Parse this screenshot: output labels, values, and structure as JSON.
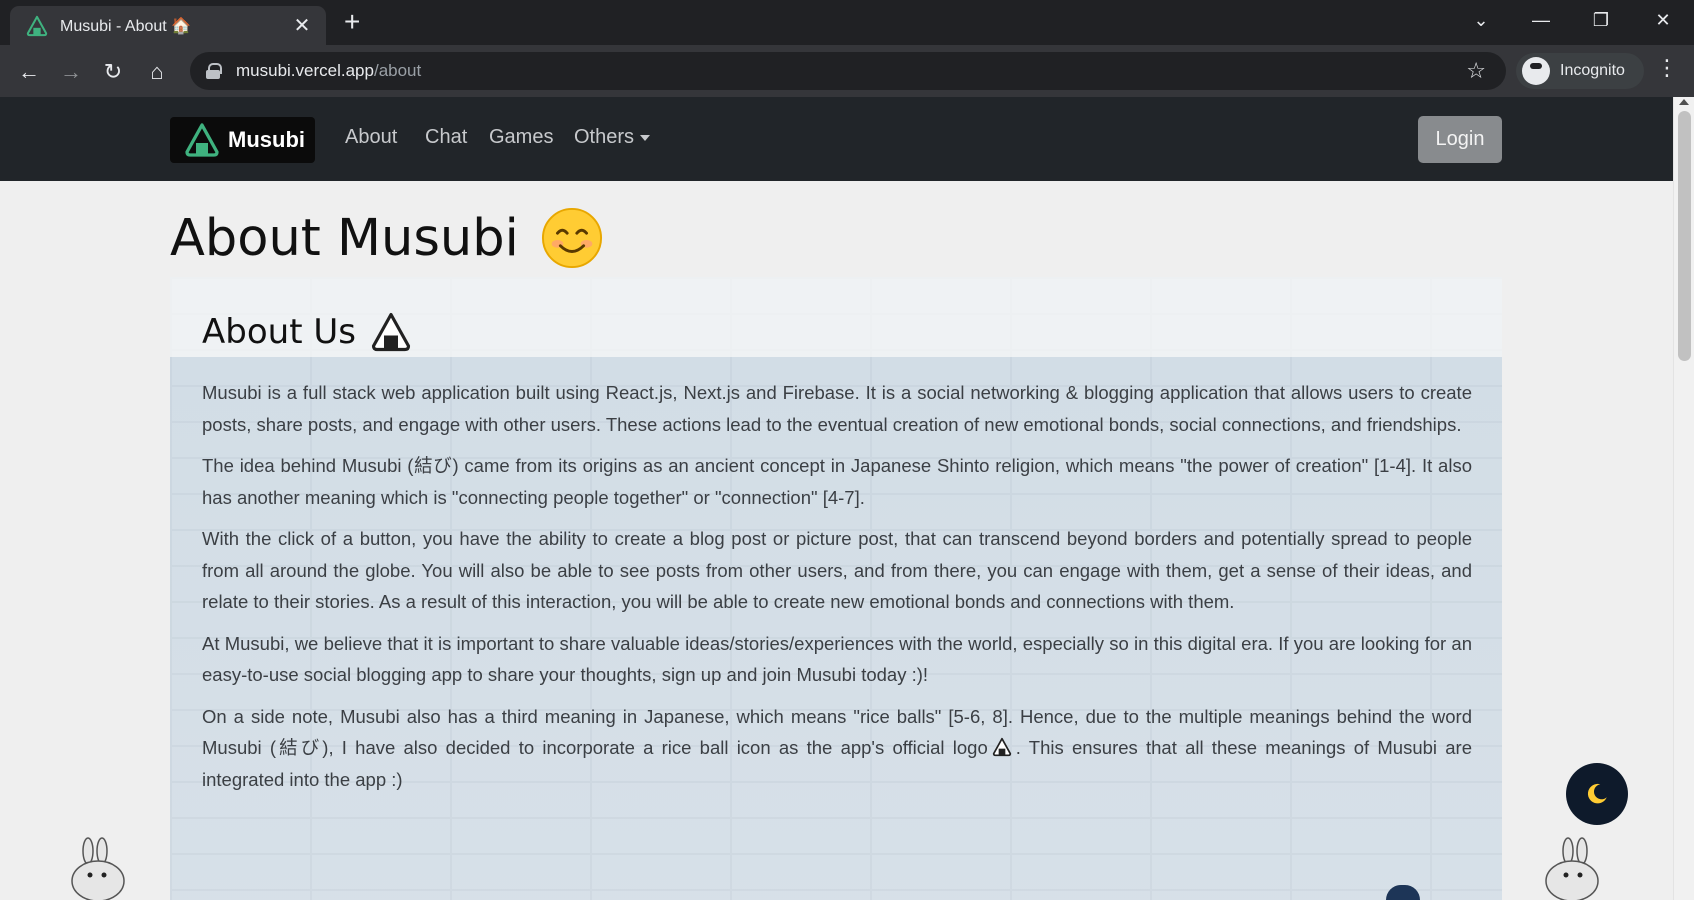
{
  "browser": {
    "tab_title": "Musubi - About 🏠",
    "new_tab_symbol": "+",
    "url_host": "musubi.vercel.app",
    "url_path": "/about",
    "profile_label": "Incognito"
  },
  "site": {
    "brand": "Musubi",
    "nav": {
      "about": "About",
      "chat": "Chat",
      "games": "Games",
      "others": "Others"
    },
    "login": "Login"
  },
  "page": {
    "title": "About Musubi",
    "section_heading": "About Us",
    "p1": "Musubi is a full stack web application built using React.js, Next.js and Firebase. It is a social networking & blogging application that allows users to create posts, share posts, and engage with other users. These actions lead to the eventual creation of new emotional bonds, social connections, and friendships.",
    "p2": "The idea behind Musubi (結び) came from its origins as an ancient concept in Japanese Shinto religion, which means \"the power of creation\" [1-4]. It also has another meaning which is \"connecting people together\" or \"connection\" [4-7].",
    "p3": "With the click of a button, you have the ability to create a blog post or picture post, that can transcend beyond borders and potentially spread to people from all around the globe. You will also be able to see posts from other users, and from there, you can engage with them, get a sense of their ideas, and relate to their stories. As a result of this interaction, you will be able to create new emotional bonds and connections with them.",
    "p4": "At Musubi, we believe that it is important to share valuable ideas/stories/experiences with the world, especially so in this digital era. If you are looking for an easy-to-use social blogging app to share your thoughts, sign up and join Musubi today :)!",
    "p5_before_icon": "On a side note, Musubi also has a third meaning in Japanese, which means \"rice balls\" [5-6, 8]. Hence, due to the multiple meanings behind the word Musubi (結び), I have also decided to incorporate a rice ball icon as the app's official logo",
    "p5_after_icon": ". This ensures that all these meanings of Musubi are integrated into the app :)"
  },
  "icons": {
    "back": "arrow-left-icon",
    "forward": "arrow-right-icon",
    "reload": "reload-icon",
    "home": "home-icon",
    "star": "star-icon",
    "menu": "more-vert-icon",
    "dark_mode": "moon-icon",
    "logo": "rice-ball-icon"
  },
  "colors": {
    "navbar": "#212529",
    "brand_bg": "#0b0b0b",
    "logo_green": "#3fb27f",
    "login_bg": "#888b8e",
    "dark_mode_btn": "#0e1a2b",
    "moon": "#ffcc33"
  }
}
